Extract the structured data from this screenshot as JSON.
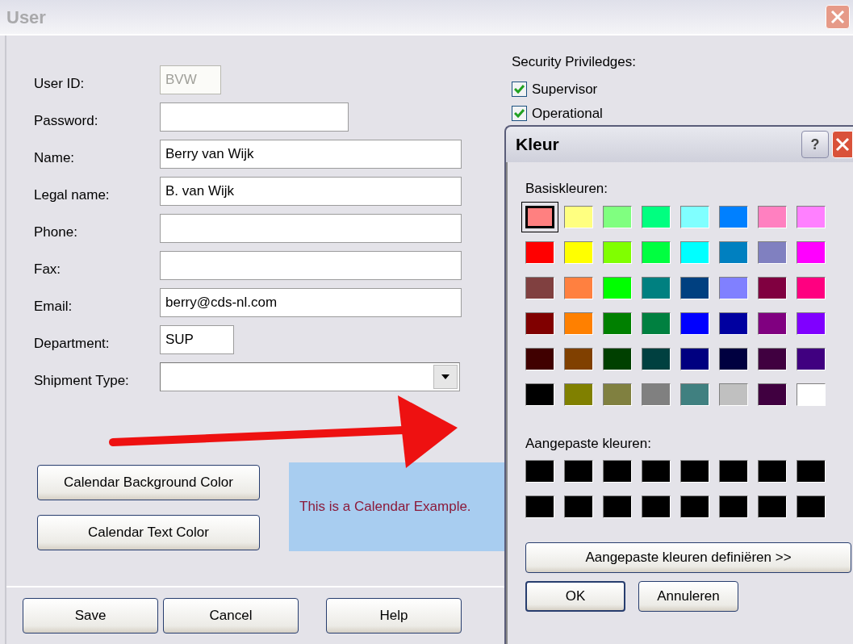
{
  "window": {
    "title": "User"
  },
  "fields": [
    {
      "label": "User ID:",
      "value": "BVW",
      "disabled": true
    },
    {
      "label": "Password:",
      "disabled": false
    },
    {
      "label": "Name:",
      "value": "Berry van Wijk",
      "disabled": false
    },
    {
      "label": "Legal name:",
      "value": "B. van Wijk",
      "disabled": false
    },
    {
      "label": "Phone:",
      "disabled": false
    },
    {
      "label": "Fax:",
      "disabled": false
    },
    {
      "label": "Email:",
      "value": "berry@cds-nl.com",
      "disabled": false
    },
    {
      "label": "Department:",
      "value": "SUP",
      "disabled": false
    },
    {
      "label": "Shipment Type:",
      "disabled": false,
      "kind": "dropdown"
    }
  ],
  "security": {
    "title": "Security Priviledges:",
    "options": [
      {
        "label": "Supervisor",
        "checked": true
      },
      {
        "label": "Operational",
        "checked": true
      }
    ]
  },
  "calendar_buttons": [
    "Calendar Background Color",
    "Calendar Text Color"
  ],
  "calendar_example": {
    "text": "This is a Calendar Example."
  },
  "buttons": [
    "Save",
    "Cancel",
    "Help"
  ],
  "color_dialog": {
    "title": "Kleur",
    "help_button": "?",
    "basic_label": "Basiskleuren:",
    "basic_colors": [
      {
        "color": "#ff8080",
        "selected": true
      },
      {
        "color": "#ffff80",
        "selected": false
      },
      {
        "color": "#80ff80",
        "selected": false
      },
      {
        "color": "#00ff80",
        "selected": false
      },
      {
        "color": "#80ffff",
        "selected": false
      },
      {
        "color": "#0080ff",
        "selected": false
      },
      {
        "color": "#ff80c0",
        "selected": false
      },
      {
        "color": "#ff80ff",
        "selected": false
      },
      {
        "color": "#ff0000",
        "selected": false
      },
      {
        "color": "#ffff00",
        "selected": false
      },
      {
        "color": "#80ff00",
        "selected": false
      },
      {
        "color": "#00ff40",
        "selected": false
      },
      {
        "color": "#00ffff",
        "selected": false
      },
      {
        "color": "#0080c0",
        "selected": false
      },
      {
        "color": "#8080c0",
        "selected": false
      },
      {
        "color": "#ff00ff",
        "selected": false
      },
      {
        "color": "#804040",
        "selected": false
      },
      {
        "color": "#ff8040",
        "selected": false
      },
      {
        "color": "#00ff00",
        "selected": false
      },
      {
        "color": "#008080",
        "selected": false
      },
      {
        "color": "#004080",
        "selected": false
      },
      {
        "color": "#8080ff",
        "selected": false
      },
      {
        "color": "#800040",
        "selected": false
      },
      {
        "color": "#ff0080",
        "selected": false
      },
      {
        "color": "#800000",
        "selected": false
      },
      {
        "color": "#ff8000",
        "selected": false
      },
      {
        "color": "#008000",
        "selected": false
      },
      {
        "color": "#008040",
        "selected": false
      },
      {
        "color": "#0000ff",
        "selected": false
      },
      {
        "color": "#0000a0",
        "selected": false
      },
      {
        "color": "#800080",
        "selected": false
      },
      {
        "color": "#8000ff",
        "selected": false
      },
      {
        "color": "#400000",
        "selected": false
      },
      {
        "color": "#804000",
        "selected": false
      },
      {
        "color": "#004000",
        "selected": false
      },
      {
        "color": "#004040",
        "selected": false
      },
      {
        "color": "#000080",
        "selected": false
      },
      {
        "color": "#000040",
        "selected": false
      },
      {
        "color": "#400040",
        "selected": false
      },
      {
        "color": "#400080",
        "selected": false
      },
      {
        "color": "#000000",
        "selected": false
      },
      {
        "color": "#808000",
        "selected": false
      },
      {
        "color": "#808040",
        "selected": false
      },
      {
        "color": "#808080",
        "selected": false
      },
      {
        "color": "#408080",
        "selected": false
      },
      {
        "color": "#c0c0c0",
        "selected": false
      },
      {
        "color": "#400040",
        "selected": false
      },
      {
        "color": "#ffffff",
        "selected": false
      }
    ],
    "custom_label": "Aangepaste kleuren:",
    "custom_colors": [
      {
        "color": "#000000"
      },
      {
        "color": "#000000"
      },
      {
        "color": "#000000"
      },
      {
        "color": "#000000"
      },
      {
        "color": "#000000"
      },
      {
        "color": "#000000"
      },
      {
        "color": "#000000"
      },
      {
        "color": "#000000"
      },
      {
        "color": "#000000"
      },
      {
        "color": "#000000"
      },
      {
        "color": "#000000"
      },
      {
        "color": "#000000"
      },
      {
        "color": "#000000"
      },
      {
        "color": "#000000"
      },
      {
        "color": "#000000"
      },
      {
        "color": "#000000"
      }
    ],
    "define_button": "Aangepaste kleuren definiëren >>",
    "buttons": [
      "OK",
      "Annuleren"
    ]
  }
}
